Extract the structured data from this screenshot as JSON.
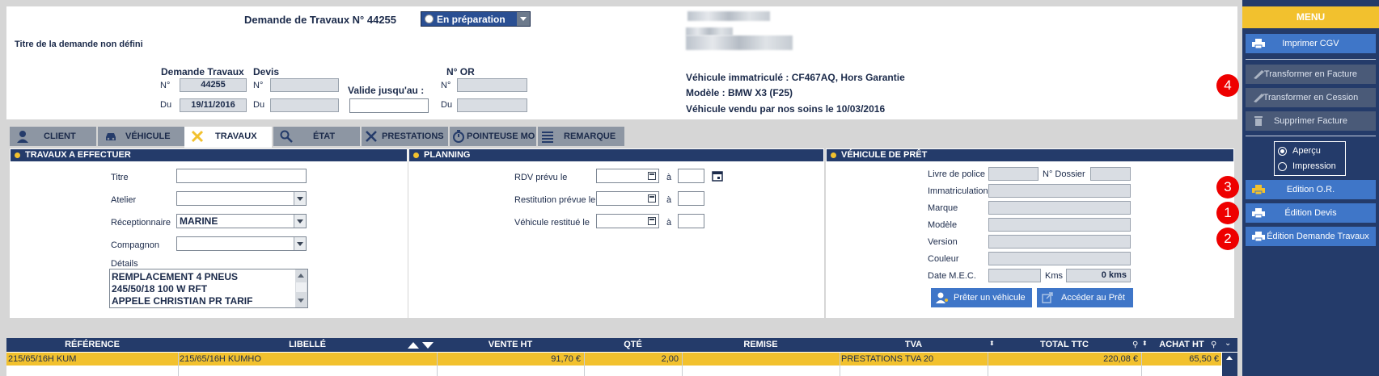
{
  "header": {
    "title": "Demande de Travaux N° 44255",
    "status": "En préparation",
    "subtitle": "Titre de la demande non défini",
    "dt_label": "Demande Travaux",
    "devis_label": "Devis",
    "valid_label": "Valide jusqu'au :",
    "or_label": "N° OR",
    "no_label": "N°",
    "du_label": "Du",
    "dt_number": "44255",
    "dt_date": "19/11/2016",
    "devis_number": "",
    "devis_date": "",
    "valid_date": "",
    "or_number": "",
    "or_date": ""
  },
  "vehicle_info": {
    "line1": "Véhicule immatriculé : CF467AQ, Hors Garantie",
    "line2": "Modèle : BMW X3 (F25)",
    "line3": "Véhicule vendu par nos soins le 10/03/2016"
  },
  "tabs": [
    {
      "label": "CLIENT",
      "icon": "person-icon"
    },
    {
      "label": "VÉHICULE",
      "icon": "car-icon"
    },
    {
      "label": "TRAVAUX",
      "icon": "tools-icon"
    },
    {
      "label": "ÉTAT",
      "icon": "magnifier-icon"
    },
    {
      "label": "PRESTATIONS",
      "icon": "wrench-icon"
    },
    {
      "label": "POINTEUSE MO",
      "icon": "stopwatch-icon"
    },
    {
      "label": "REMARQUE",
      "icon": "list-icon"
    }
  ],
  "travaux": {
    "header": "TRAVAUX A EFFECTUER",
    "titre_label": "Titre",
    "titre_value": "",
    "atelier_label": "Atelier",
    "atelier_value": "",
    "receptionnaire_label": "Réceptionnaire",
    "receptionnaire_value": "MARINE",
    "compagnon_label": "Compagnon",
    "compagnon_value": "",
    "details_label": "Détails",
    "details_lines": [
      "REMPLACEMENT 4 PNEUS",
      "245/50/18 100 W RFT",
      "APPELE CHRISTIAN PR TARIF"
    ]
  },
  "planning": {
    "header": "PLANNING",
    "rdv_label": "RDV prévu le",
    "restitution_label": "Restitution prévue le",
    "restitue_label": "Véhicule restitué le",
    "a_label": "à"
  },
  "pret": {
    "header": "VÉHICULE DE PRÊT",
    "livre_label": "Livre de police",
    "dossier_label": "N° Dossier",
    "immat_label": "Immatriculation",
    "marque_label": "Marque",
    "modele_label": "Modèle",
    "version_label": "Version",
    "couleur_label": "Couleur",
    "mec_label": "Date M.E.C.",
    "kms_label": "Kms",
    "kms_value": "0 kms",
    "preter_button": "Prêter un véhicule",
    "acceder_button": "Accéder au Prêt"
  },
  "table": {
    "headers": [
      "RÉFÉRENCE",
      "LIBELLÉ",
      "VENTE HT",
      "QTÉ",
      "REMISE",
      "TVA",
      "TOTAL TTC",
      "ACHAT HT"
    ],
    "rows": [
      [
        "215/65/16H KUM",
        "215/65/16H KUMHO",
        "91,70 €",
        "2,00",
        "",
        "PRESTATIONS TVA 20",
        "220,08 €",
        "65,50 €"
      ]
    ]
  },
  "menu": {
    "title": "MENU",
    "imprimer_cgv": "Imprimer CGV",
    "transformer_facture": "Transformer en Facture",
    "transformer_cession": "Transformer en Cession",
    "supprimer_facture": "Supprimer Facture",
    "apercu": "Aperçu",
    "impression": "Impression",
    "edition_or": "Edition O.R.",
    "edition_devis": "Édition Devis",
    "edition_dt": "Édition Demande Travaux"
  },
  "badges": [
    "4",
    "3",
    "1",
    "2"
  ],
  "colors": {
    "navy": "#243b6a",
    "accent": "#f2c12e",
    "button": "#3f76c8",
    "badge": "#e00000"
  }
}
